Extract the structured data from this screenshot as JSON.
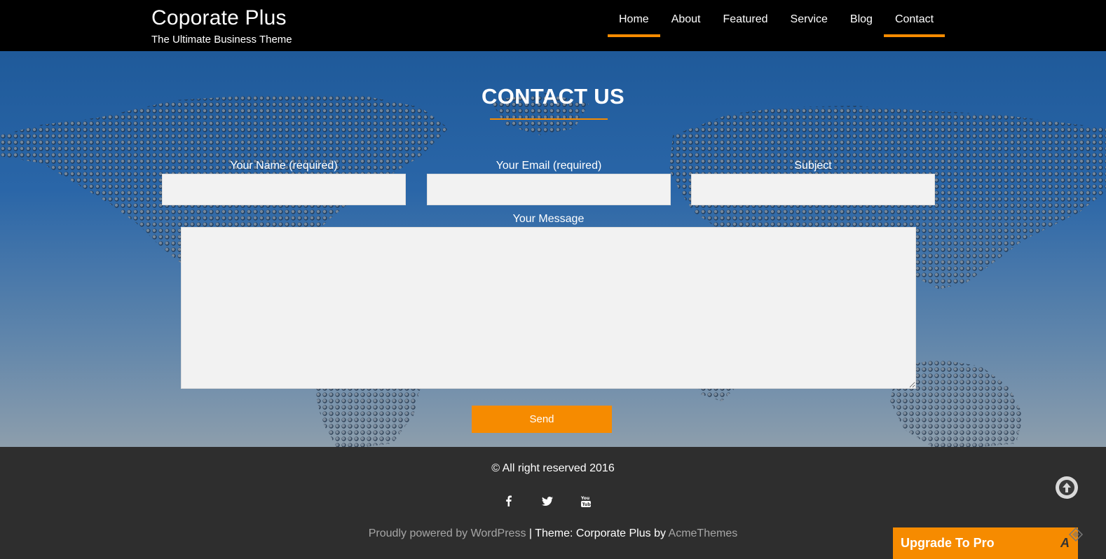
{
  "header": {
    "site_title": "Coporate Plus",
    "tagline": "The Ultimate Business Theme",
    "nav": [
      {
        "label": "Home"
      },
      {
        "label": "About"
      },
      {
        "label": "Featured"
      },
      {
        "label": "Service"
      },
      {
        "label": "Blog"
      },
      {
        "label": "Contact"
      }
    ],
    "active_nav": [
      "Home",
      "Contact"
    ]
  },
  "contact": {
    "title": "CONTACT US",
    "name_label": "Your Name (required)",
    "email_label": "Your Email (required)",
    "subject_label": "Subject",
    "message_label": "Your Message",
    "name_value": "",
    "email_value": "",
    "subject_value": "",
    "message_value": "",
    "send_label": "Send"
  },
  "footer": {
    "copyright": "© All right reserved 2016",
    "social": [
      "facebook-icon",
      "twitter-icon",
      "youtube-icon"
    ],
    "credits_prefix": "Proudly powered by WordPress",
    "credits_sep": " | Theme: Corporate Plus by ",
    "credits_author": "AcmeThemes"
  },
  "upgrade": {
    "label": "Upgrade To Pro",
    "glyph": "A"
  },
  "colors": {
    "accent": "#f68b00",
    "header_bg": "#000000",
    "footer_bg": "#2e2e2e",
    "field_bg": "#f2f2f2"
  }
}
